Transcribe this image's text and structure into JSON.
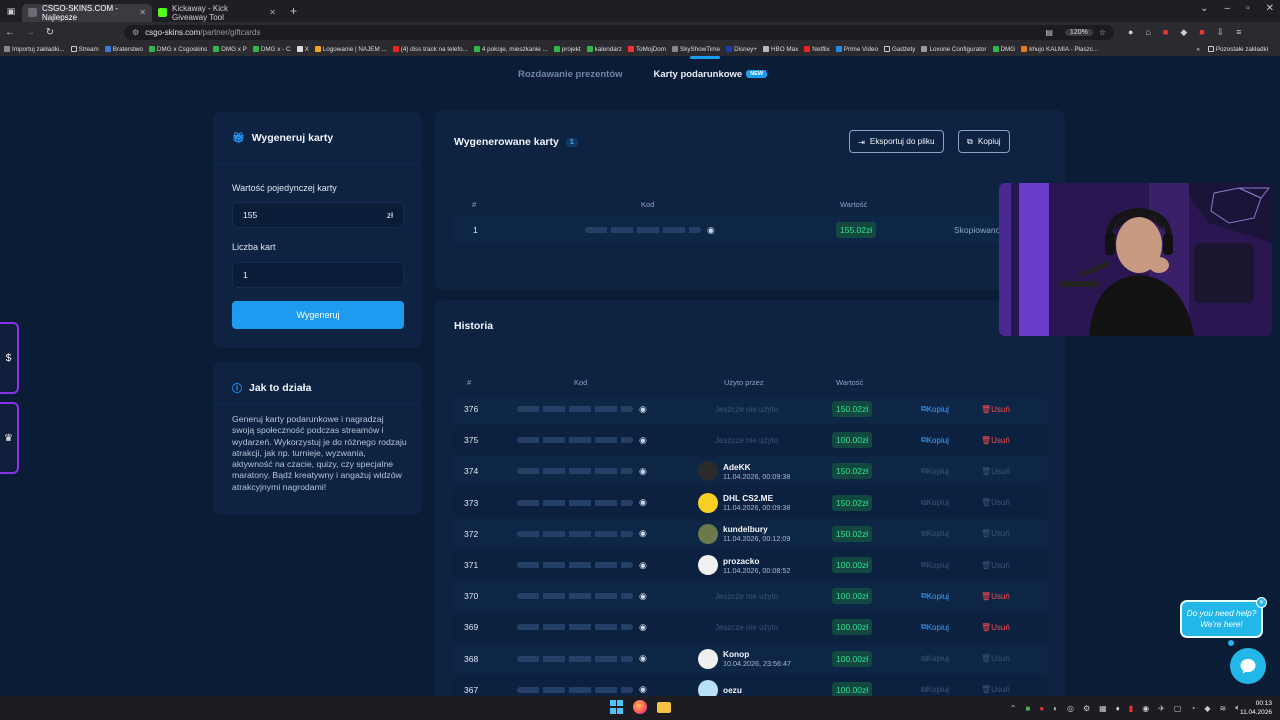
{
  "browser": {
    "tabs": [
      {
        "title": "CSGO-SKINS.COM - Najlepsze",
        "active": true,
        "color": "#6b6b75"
      },
      {
        "title": "Kickaway - Kick Giveaway Tool",
        "active": false,
        "color": "#53fc18"
      }
    ],
    "url_host": "csgo-skins.com",
    "url_path": "/partner/giftcards",
    "zoom": "120%",
    "bookmarks": [
      "Importuj zakładki...",
      "Stream",
      "Braterstwo",
      "DMG x Csgoskins",
      "DMG x P",
      "DMG x - C",
      "X",
      "Logowanie | NAJEM ...",
      "(4) diss track na telefo...",
      "4 pokoje, mieszkanie ...",
      "projekt",
      "kalendarz",
      "ToMojDom",
      "SkyShowTime",
      "Disney+",
      "HBO Max",
      "Netflix",
      "Prime Video",
      "Gadżety",
      "Loxone Configurator",
      "DMG",
      "khujo KALMIA - Płaszc..."
    ],
    "bookmarks_other": "Pozostałe zakładki"
  },
  "subnav": {
    "tab1": "Rozdawanie prezentów",
    "tab2": "Karty podarunkowe",
    "new_badge": "NEW"
  },
  "generate": {
    "title": "Wygeneruj karty",
    "value_label": "Wartość pojedynczej karty",
    "value": "155",
    "currency": "zł",
    "count_label": "Liczba kart",
    "count": "1",
    "button": "Wygeneruj"
  },
  "howto": {
    "title": "Jak to działa",
    "text": "Generuj karty podarunkowe i nagradzaj swoją społeczność podczas streamów i wydarzeń. Wykorzystuj je do różnego rodzaju atrakcji, jak np. turnieje, wyzwania, aktywność na czacie, quizy, czy specjalne maratony. Bądź kreatywny i angażuj widzów atrakcyjnymi nagrodami!"
  },
  "generated": {
    "title": "Wygenerowane karty",
    "count": "1",
    "export_button": "Eksportuj do pliku",
    "copy_button": "Kopiuj",
    "headers": {
      "num": "#",
      "code": "Kod",
      "value": "Wartość"
    },
    "row": {
      "num": "1",
      "value": "155.02zł",
      "status": "Skopiowano"
    }
  },
  "history": {
    "title": "Historia",
    "headers": {
      "num": "#",
      "code": "Kod",
      "used_by": "Użyto przez",
      "value": "Wartość"
    },
    "unused_text": "Jeszcze nie użyto",
    "copy_label": "Kopiuj",
    "delete_label": "Usuń",
    "rows": [
      {
        "num": "376",
        "value": "150.02zł",
        "user": null,
        "time": null
      },
      {
        "num": "375",
        "value": "100.00zł",
        "user": null,
        "time": null
      },
      {
        "num": "374",
        "value": "150.02zł",
        "user": "AdeKK",
        "time": "11.04.2026, 00:09:38"
      },
      {
        "num": "373",
        "value": "150.02zł",
        "user": "DHL CS2.ME",
        "time": "11.04.2026, 00:09:38"
      },
      {
        "num": "372",
        "value": "150.02zł",
        "user": "kundelbury",
        "time": "11.04.2026, 00:12:09"
      },
      {
        "num": "371",
        "value": "100.00zł",
        "user": "prozacko",
        "time": "11.04.2026, 00:08:52"
      },
      {
        "num": "370",
        "value": "100.00zł",
        "user": null,
        "time": null
      },
      {
        "num": "369",
        "value": "100.00zł",
        "user": null,
        "time": null
      },
      {
        "num": "368",
        "value": "100.00zł",
        "user": "Konop",
        "time": "10.04.2026, 23:56:47"
      },
      {
        "num": "367",
        "value": "100.00zł",
        "user": "oezu",
        "time": ""
      }
    ]
  },
  "help": {
    "line1": "Do you need help?",
    "line2": "We're here!"
  },
  "taskbar": {
    "time": "00:13",
    "date": "11.04.2026"
  },
  "colors": {
    "accent": "#1d9bf0",
    "value_green": "#33e08f",
    "delete_red": "#ff4a4a",
    "sidebar_purple": "#8a32e8"
  }
}
